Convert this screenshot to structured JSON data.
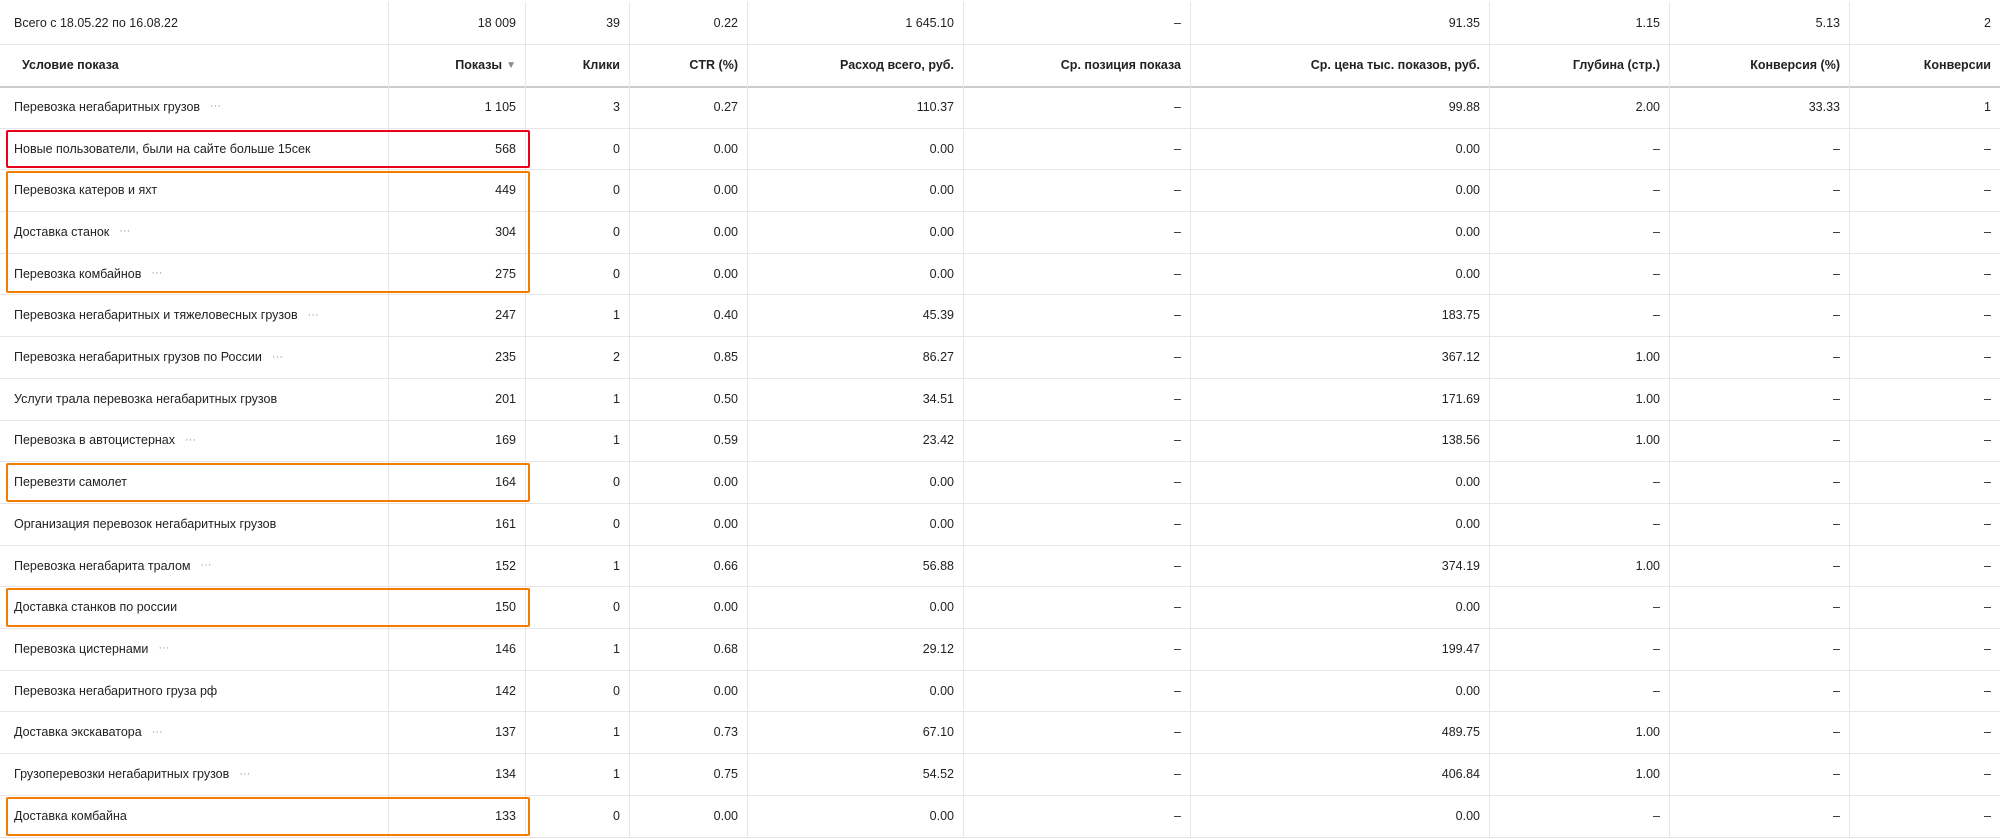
{
  "columns": {
    "condition": "Условие показа",
    "impressions": "Показы",
    "clicks": "Клики",
    "ctr": "CTR (%)",
    "spend": "Расход всего, руб.",
    "avg_position": "Ср. позиция показа",
    "cpm": "Ср. цена тыс. показов, руб.",
    "depth": "Глубина (стр.)",
    "conv_rate": "Конверсия (%)",
    "conversions": "Конверсии"
  },
  "totals": {
    "label": "Всего с 18.05.22 по 16.08.22",
    "impressions": "18 009",
    "clicks": "39",
    "ctr": "0.22",
    "spend": "1 645.10",
    "avg_position": "–",
    "cpm": "91.35",
    "depth": "1.15",
    "conv_rate": "5.13",
    "conversions": "2"
  },
  "rows": [
    {
      "name": "Перевозка негабаритных грузов",
      "more": true,
      "impressions": "1 105",
      "clicks": "3",
      "ctr": "0.27",
      "spend": "110.37",
      "avg_position": "–",
      "cpm": "99.88",
      "depth": "2.00",
      "conv_rate": "33.33",
      "conversions": "1"
    },
    {
      "name": "Новые пользователи, были на сайте больше 15сек",
      "more": false,
      "highlight": "red",
      "impressions": "568",
      "clicks": "0",
      "ctr": "0.00",
      "spend": "0.00",
      "avg_position": "–",
      "cpm": "0.00",
      "depth": "–",
      "conv_rate": "–",
      "conversions": "–"
    },
    {
      "name": "Перевозка катеров и яхт",
      "more": false,
      "impressions": "449",
      "clicks": "0",
      "ctr": "0.00",
      "spend": "0.00",
      "avg_position": "–",
      "cpm": "0.00",
      "depth": "–",
      "conv_rate": "–",
      "conversions": "–"
    },
    {
      "name": "Доставка станок",
      "more": true,
      "impressions": "304",
      "clicks": "0",
      "ctr": "0.00",
      "spend": "0.00",
      "avg_position": "–",
      "cpm": "0.00",
      "depth": "–",
      "conv_rate": "–",
      "conversions": "–"
    },
    {
      "name": "Перевозка комбайнов",
      "more": true,
      "impressions": "275",
      "clicks": "0",
      "ctr": "0.00",
      "spend": "0.00",
      "avg_position": "–",
      "cpm": "0.00",
      "depth": "–",
      "conv_rate": "–",
      "conversions": "–"
    },
    {
      "name": "Перевозка негабаритных и тяжеловесных грузов",
      "more": true,
      "impressions": "247",
      "clicks": "1",
      "ctr": "0.40",
      "spend": "45.39",
      "avg_position": "–",
      "cpm": "183.75",
      "depth": "–",
      "conv_rate": "–",
      "conversions": "–"
    },
    {
      "name": "Перевозка негабаритных грузов по России",
      "more": true,
      "impressions": "235",
      "clicks": "2",
      "ctr": "0.85",
      "spend": "86.27",
      "avg_position": "–",
      "cpm": "367.12",
      "depth": "1.00",
      "conv_rate": "–",
      "conversions": "–"
    },
    {
      "name": "Услуги трала перевозка негабаритных грузов",
      "more": false,
      "impressions": "201",
      "clicks": "1",
      "ctr": "0.50",
      "spend": "34.51",
      "avg_position": "–",
      "cpm": "171.69",
      "depth": "1.00",
      "conv_rate": "–",
      "conversions": "–"
    },
    {
      "name": "Перевозка в автоцистернах",
      "more": true,
      "impressions": "169",
      "clicks": "1",
      "ctr": "0.59",
      "spend": "23.42",
      "avg_position": "–",
      "cpm": "138.56",
      "depth": "1.00",
      "conv_rate": "–",
      "conversions": "–"
    },
    {
      "name": "Перевезти самолет",
      "more": false,
      "impressions": "164",
      "clicks": "0",
      "ctr": "0.00",
      "spend": "0.00",
      "avg_position": "–",
      "cpm": "0.00",
      "depth": "–",
      "conv_rate": "–",
      "conversions": "–"
    },
    {
      "name": "Организация перевозок негабаритных грузов",
      "more": false,
      "impressions": "161",
      "clicks": "0",
      "ctr": "0.00",
      "spend": "0.00",
      "avg_position": "–",
      "cpm": "0.00",
      "depth": "–",
      "conv_rate": "–",
      "conversions": "–"
    },
    {
      "name": "Перевозка негабарита тралом",
      "more": true,
      "impressions": "152",
      "clicks": "1",
      "ctr": "0.66",
      "spend": "56.88",
      "avg_position": "–",
      "cpm": "374.19",
      "depth": "1.00",
      "conv_rate": "–",
      "conversions": "–"
    },
    {
      "name": "Доставка станков по россии",
      "more": false,
      "impressions": "150",
      "clicks": "0",
      "ctr": "0.00",
      "spend": "0.00",
      "avg_position": "–",
      "cpm": "0.00",
      "depth": "–",
      "conv_rate": "–",
      "conversions": "–"
    },
    {
      "name": "Перевозка цистернами",
      "more": true,
      "impressions": "146",
      "clicks": "1",
      "ctr": "0.68",
      "spend": "29.12",
      "avg_position": "–",
      "cpm": "199.47",
      "depth": "–",
      "conv_rate": "–",
      "conversions": "–"
    },
    {
      "name": "Перевозка негабаритного груза рф",
      "more": false,
      "impressions": "142",
      "clicks": "0",
      "ctr": "0.00",
      "spend": "0.00",
      "avg_position": "–",
      "cpm": "0.00",
      "depth": "–",
      "conv_rate": "–",
      "conversions": "–"
    },
    {
      "name": "Доставка экскаватора",
      "more": true,
      "impressions": "137",
      "clicks": "1",
      "ctr": "0.73",
      "spend": "67.10",
      "avg_position": "–",
      "cpm": "489.75",
      "depth": "1.00",
      "conv_rate": "–",
      "conversions": "–"
    },
    {
      "name": "Грузоперевозки негабаритных грузов",
      "more": true,
      "impressions": "134",
      "clicks": "1",
      "ctr": "0.75",
      "spend": "54.52",
      "avg_position": "–",
      "cpm": "406.84",
      "depth": "1.00",
      "conv_rate": "–",
      "conversions": "–"
    },
    {
      "name": "Доставка комбайна",
      "more": false,
      "impressions": "133",
      "clicks": "0",
      "ctr": "0.00",
      "spend": "0.00",
      "avg_position": "–",
      "cpm": "0.00",
      "depth": "–",
      "conv_rate": "–",
      "conversions": "–"
    }
  ],
  "icons": {
    "more": "more-dots-icon",
    "sort": "sort-desc-icon"
  },
  "colors": {
    "highlight_red": "#e8001c",
    "highlight_orange": "#f47c00",
    "grid": "#e6e6e6"
  }
}
